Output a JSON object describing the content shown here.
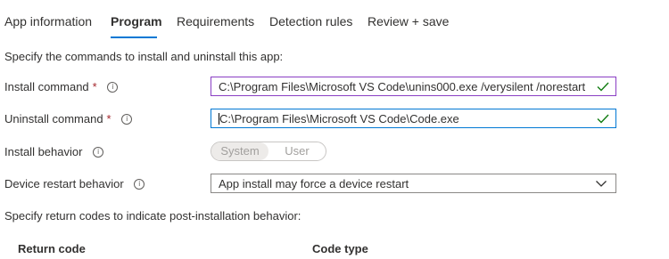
{
  "tabs": [
    {
      "label": "App information"
    },
    {
      "label": "Program"
    },
    {
      "label": "Requirements"
    },
    {
      "label": "Detection rules"
    },
    {
      "label": "Review + save"
    }
  ],
  "intro": "Specify the commands to install and uninstall this app:",
  "install_command": {
    "label": "Install command",
    "required_mark": "*",
    "value": "C:\\Program Files\\Microsoft VS Code\\unins000.exe /verysilent /norestart"
  },
  "uninstall_command": {
    "label": "Uninstall command",
    "required_mark": "*",
    "value": "C:\\Program Files\\Microsoft VS Code\\Code.exe"
  },
  "install_behavior": {
    "label": "Install behavior",
    "options": [
      "System",
      "User"
    ],
    "selected": "System"
  },
  "restart_behavior": {
    "label": "Device restart behavior",
    "selected": "App install may force a device restart"
  },
  "return_codes_intro": "Specify return codes to indicate post-installation behavior:",
  "table": {
    "headers": [
      "Return code",
      "Code type"
    ]
  },
  "colors": {
    "accent": "#0078d4",
    "focus_purple": "#8a3ec4",
    "valid_green": "#107c10",
    "required_red": "#a4262c"
  }
}
